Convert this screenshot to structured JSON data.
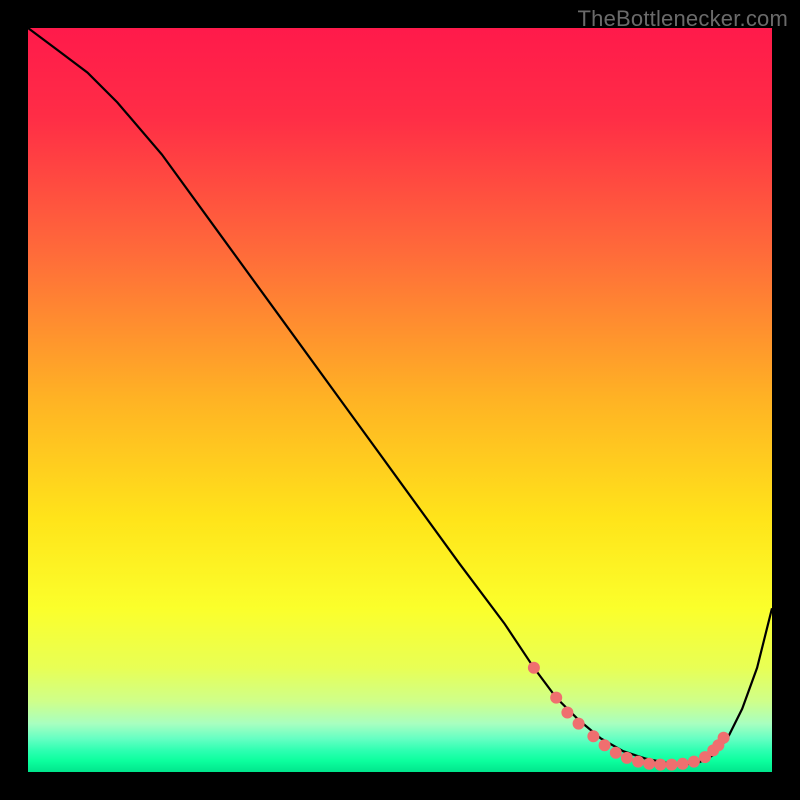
{
  "attribution": "TheBottlenecker.com",
  "chart_data": {
    "type": "line",
    "title": "",
    "xlabel": "",
    "ylabel": "",
    "xlim": [
      0,
      100
    ],
    "ylim": [
      0,
      100
    ],
    "grid": false,
    "legend": false,
    "gradient_stops": [
      {
        "offset": 0.0,
        "color": "#ff1a4b"
      },
      {
        "offset": 0.12,
        "color": "#ff2d46"
      },
      {
        "offset": 0.3,
        "color": "#ff6a3a"
      },
      {
        "offset": 0.5,
        "color": "#ffb324"
      },
      {
        "offset": 0.66,
        "color": "#ffe41a"
      },
      {
        "offset": 0.78,
        "color": "#fbff2b"
      },
      {
        "offset": 0.86,
        "color": "#e8ff55"
      },
      {
        "offset": 0.905,
        "color": "#cfff8a"
      },
      {
        "offset": 0.935,
        "color": "#a8ffc0"
      },
      {
        "offset": 0.955,
        "color": "#66ffc3"
      },
      {
        "offset": 0.972,
        "color": "#2bffb0"
      },
      {
        "offset": 0.985,
        "color": "#0cff9e"
      },
      {
        "offset": 1.0,
        "color": "#00e58c"
      }
    ],
    "series": [
      {
        "name": "bottleneck-curve",
        "stroke": "#000000",
        "x": [
          0,
          4,
          8,
          12,
          18,
          26,
          34,
          42,
          50,
          58,
          64,
          68,
          71,
          74,
          77,
          80,
          83,
          86,
          88,
          90,
          92,
          94,
          96,
          98,
          100
        ],
        "y": [
          100,
          97,
          94,
          90,
          83,
          72,
          61,
          50,
          39,
          28,
          20,
          14,
          10,
          7,
          4.5,
          2.8,
          1.8,
          1.2,
          1.0,
          1.2,
          2.2,
          4.5,
          8.5,
          14,
          22
        ]
      }
    ],
    "markers": {
      "name": "highlight-points",
      "color": "#ef6f6f",
      "radius": 6,
      "points": [
        {
          "x": 68,
          "y": 14
        },
        {
          "x": 71,
          "y": 10
        },
        {
          "x": 72.5,
          "y": 8
        },
        {
          "x": 74,
          "y": 6.5
        },
        {
          "x": 76,
          "y": 4.8
        },
        {
          "x": 77.5,
          "y": 3.6
        },
        {
          "x": 79,
          "y": 2.6
        },
        {
          "x": 80.5,
          "y": 1.9
        },
        {
          "x": 82,
          "y": 1.4
        },
        {
          "x": 83.5,
          "y": 1.1
        },
        {
          "x": 85,
          "y": 1.0
        },
        {
          "x": 86.5,
          "y": 1.0
        },
        {
          "x": 88,
          "y": 1.1
        },
        {
          "x": 89.5,
          "y": 1.4
        },
        {
          "x": 91,
          "y": 2.0
        },
        {
          "x": 92.1,
          "y": 2.9
        },
        {
          "x": 92.8,
          "y": 3.6
        },
        {
          "x": 93.5,
          "y": 4.6
        }
      ]
    }
  }
}
